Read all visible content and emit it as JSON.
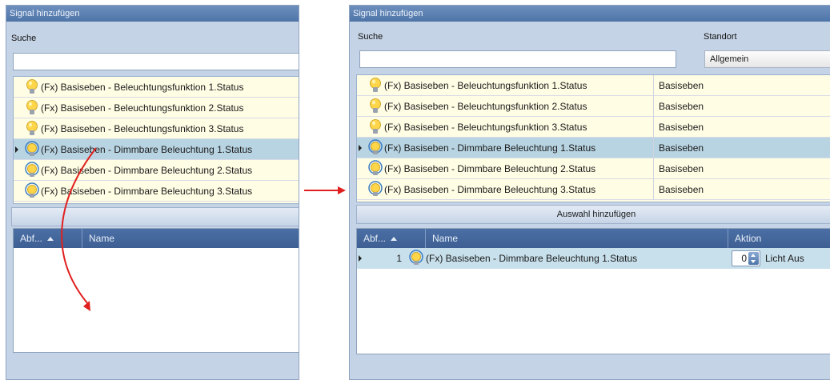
{
  "left_window": {
    "title": "Signal hinzufügen",
    "search_label": "Suche",
    "search_value": "",
    "signals": [
      {
        "label": "(Fx) Basiseben - Beleuchtungsfunktion 1.Status",
        "icon": "bulb-icon",
        "selected": false
      },
      {
        "label": "(Fx) Basiseben - Beleuchtungsfunktion 2.Status",
        "icon": "bulb-icon",
        "selected": false
      },
      {
        "label": "(Fx) Basiseben - Beleuchtungsfunktion 3.Status",
        "icon": "bulb-icon",
        "selected": false
      },
      {
        "label": "(Fx) Basiseben - Dimmbare Beleuchtung 1.Status",
        "icon": "dimmer-bulb-icon",
        "selected": true
      },
      {
        "label": "(Fx) Basiseben - Dimmbare Beleuchtung 2.Status",
        "icon": "dimmer-bulb-icon",
        "selected": false
      },
      {
        "label": "(Fx) Basiseben - Dimmbare Beleuchtung 3.Status",
        "icon": "dimmer-bulb-icon",
        "selected": false
      }
    ],
    "grid_headers": {
      "abf": "Abf...",
      "name": "Name"
    }
  },
  "right_window": {
    "title": "Signal hinzufügen",
    "search_label": "Suche",
    "search_value": "",
    "location_label": "Standort",
    "location_value": "Allgemein",
    "signals": [
      {
        "label": "(Fx) Basiseben - Beleuchtungsfunktion 1.Status",
        "location": "Basiseben",
        "icon": "bulb-icon",
        "selected": false
      },
      {
        "label": "(Fx) Basiseben - Beleuchtungsfunktion 2.Status",
        "location": "Basiseben",
        "icon": "bulb-icon",
        "selected": false
      },
      {
        "label": "(Fx) Basiseben - Beleuchtungsfunktion 3.Status",
        "location": "Basiseben",
        "icon": "bulb-icon",
        "selected": false
      },
      {
        "label": "(Fx) Basiseben - Dimmbare Beleuchtung 1.Status",
        "location": "Basiseben",
        "icon": "dimmer-bulb-icon",
        "selected": true
      },
      {
        "label": "(Fx) Basiseben - Dimmbare Beleuchtung 2.Status",
        "location": "Basiseben",
        "icon": "dimmer-bulb-icon",
        "selected": false
      },
      {
        "label": "(Fx) Basiseben - Dimmbare Beleuchtung 3.Status",
        "location": "Basiseben",
        "icon": "dimmer-bulb-icon",
        "selected": false
      }
    ],
    "add_button": "Auswahl hinzufügen",
    "grid_headers": {
      "abf": "Abf...",
      "name": "Name",
      "aktion": "Aktion"
    },
    "grid_rows": [
      {
        "abf": "1",
        "name": "(Fx) Basiseben - Dimmbare Beleuchtung 1.Status",
        "icon": "dimmer-bulb-icon",
        "value": "0",
        "action": "Licht Aus"
      }
    ]
  },
  "annotations": {
    "arrow_color": "#e0201e"
  },
  "colors": {
    "title_bar": "#5478ab",
    "window_bg": "#c5d3e6",
    "row_bg": "#fffde4",
    "row_selected": "#b8d4e2",
    "grid_header": "#4468a0"
  }
}
